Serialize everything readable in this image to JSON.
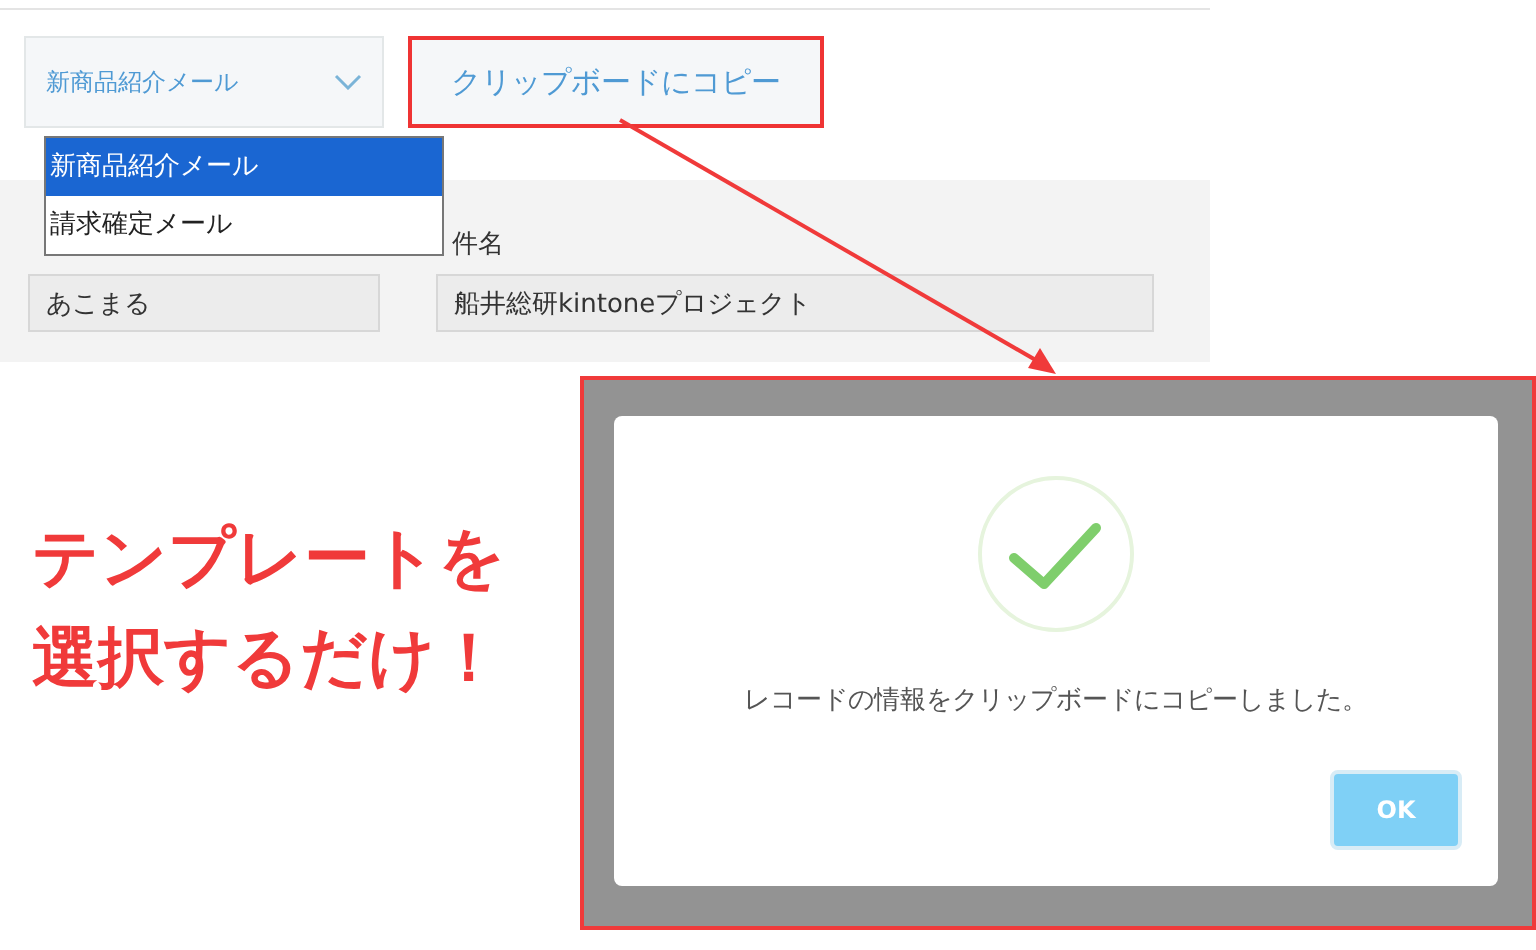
{
  "template_select": {
    "value": "新商品紹介メール",
    "options": [
      {
        "label": "新商品紹介メール",
        "selected": true
      },
      {
        "label": "請求確定メール",
        "selected": false
      }
    ]
  },
  "copy_button": {
    "label": "クリップボードにコピー"
  },
  "fields": [
    {
      "value": "あこまる"
    },
    {
      "label": "件名",
      "value": "船井総研kintoneプロジェクト"
    }
  ],
  "caption": [
    "テンプレートを",
    "選択するだけ！"
  ],
  "dialog": {
    "message": "レコードの情報をクリップボードにコピーしました。",
    "button": "OK"
  }
}
